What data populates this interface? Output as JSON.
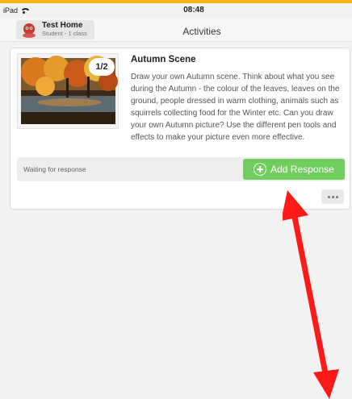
{
  "status_bar": {
    "device": "iPad",
    "time": "08:48"
  },
  "header": {
    "user_name": "Test Home",
    "user_sub": "Student - 1 class",
    "title": "Activities"
  },
  "activity": {
    "badge": "1/2",
    "title": "Autumn Scene",
    "description": "Draw your own Autumn scene. Think about what you see during the Autumn - the colour of the leaves, leaves on the ground, people dressed in warm clothing, animals such as squirrels collecting food for the Winter etc. Can you draw your own Autumn picture? Use the different pen tools and effects to make your picture even more effective.",
    "status": "Waiting for response",
    "add_label": "Add Response",
    "accent": "#6fce5e"
  },
  "annotation": {
    "arrow_color": "#ff1a1a"
  },
  "icons": [
    "wifi-icon",
    "avatar-icon",
    "plus-icon",
    "more-icon"
  ]
}
